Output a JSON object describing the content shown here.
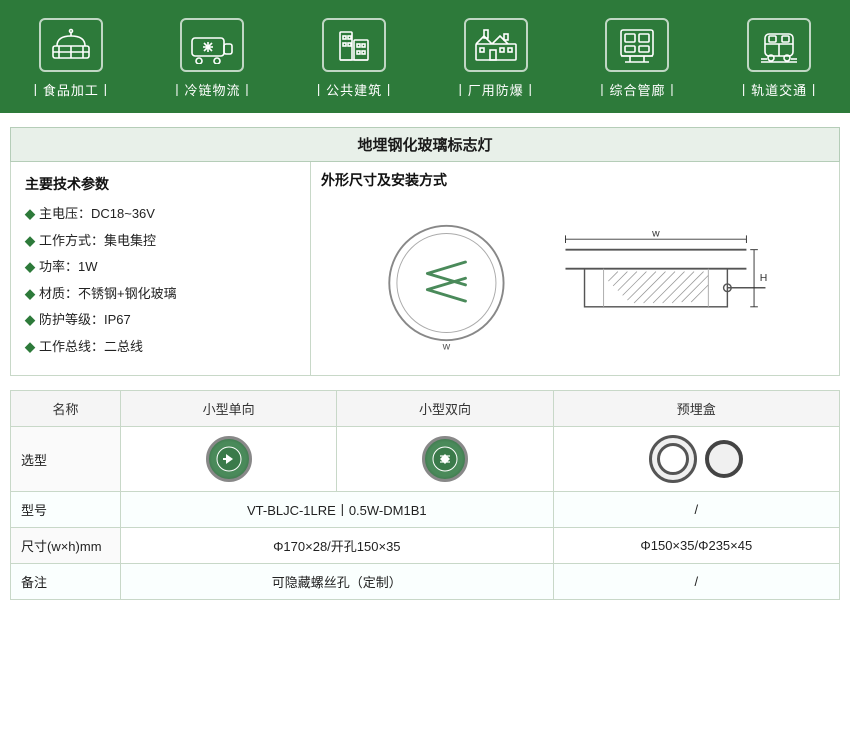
{
  "banner": {
    "items": [
      {
        "id": "food",
        "label": "丨食品加工丨"
      },
      {
        "id": "cold",
        "label": "丨冷链物流丨"
      },
      {
        "id": "building",
        "label": "丨公共建筑丨"
      },
      {
        "id": "factory",
        "label": "丨厂用防爆丨"
      },
      {
        "id": "corridor",
        "label": "丨综合管廊丨"
      },
      {
        "id": "rail",
        "label": "丨轨道交通丨"
      }
    ]
  },
  "product": {
    "title": "地埋钢化玻璃标志灯",
    "spec_left_title": "主要技术参数",
    "spec_right_title": "外形尺寸及安装方式",
    "specs": [
      "主电压：DC18~36V",
      "工作方式：集电集控",
      "功率：1W",
      "材质：不锈钢+钢化玻璃",
      "防护等级：IP67",
      "工作总线：二总线"
    ]
  },
  "table": {
    "headers": [
      "名称",
      "小型单向",
      "小型双向",
      "预埋盒"
    ],
    "rows": [
      {
        "label": "选型",
        "col1_type": "single_arrow",
        "col2_type": "double_arrow",
        "col3_type": "rings"
      },
      {
        "label": "型号",
        "col1": "VT-BLJC-1LRE丨0.5W-DM1B1",
        "col2": "VT-BLJC-1LRE丨0.5W-DM1B1",
        "col3": "/"
      },
      {
        "label": "尺寸(w×h)mm",
        "col1": "Φ170×28/开孔150×35",
        "col2": "Φ170×28/开孔150×35",
        "col3": "Φ150×35/Φ235×45"
      },
      {
        "label": "备注",
        "col1": "可隐藏螺丝孔（定制）",
        "col2": "可隐藏螺丝孔（定制）",
        "col3": "/"
      }
    ]
  }
}
